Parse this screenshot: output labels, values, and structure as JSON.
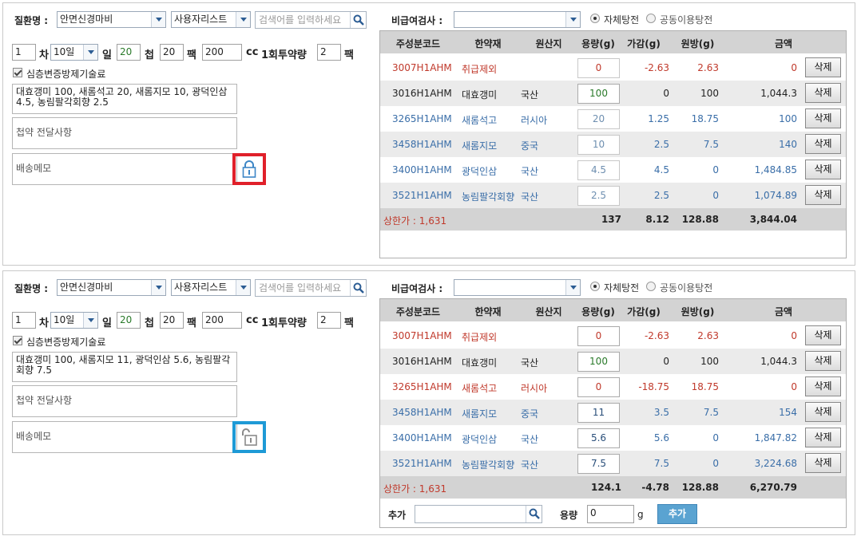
{
  "panels": [
    {
      "disease_label": "질환명 :",
      "disease_value": "안면신경마비",
      "list_value": "사용자리스트",
      "search_placeholder": "검색어를 입력하세요",
      "cha_value": "1",
      "cha_label": "차",
      "days_value": "10일",
      "il_label": "일",
      "cheop_value": "20",
      "cheop_label": "첩",
      "paek_value": "20",
      "paek_label": "팩",
      "cc_value": "200",
      "cc_label": "cc",
      "dose_label": "1회투약량",
      "dose_value": "2",
      "dose_unit": "팩",
      "check_label": "심층변증방제기술료",
      "herb_summary": "대효갱미 100, 새롬석고 20, 새롬지모 10, 광덕인삼 4.5, 농림팔각회향 2.5",
      "memo1": "첩약 전달사항",
      "memo2": "배송메모",
      "lock_state": "locked",
      "lock_color": "#e0202a",
      "clinic_label": "비급여검사 :",
      "clinic_value": "",
      "radio1": "자체탕전",
      "radio2": "공동이용탕전",
      "headers": [
        "주성분코드",
        "한약재",
        "원산지",
        "용량(g)",
        "가감(g)",
        "원방(g)",
        "금액"
      ],
      "rows": [
        {
          "code": "3007H1AHM",
          "herb": "취급제외",
          "origin": "",
          "qty": "0",
          "adj": "-2.63",
          "orig": "2.63",
          "amount": "0",
          "color": "red",
          "highlight": false,
          "del": "삭제"
        },
        {
          "code": "3016H1AHM",
          "herb": "대효갱미",
          "origin": "국산",
          "qty": "100",
          "adj": "0",
          "orig": "100",
          "amount": "1,044.3",
          "color": "blk",
          "highlight": true,
          "del": "삭제"
        },
        {
          "code": "3265H1AHM",
          "herb": "새롬석고",
          "origin": "러시아",
          "qty": "20",
          "adj": "1.25",
          "orig": "18.75",
          "amount": "100",
          "color": "blue",
          "highlight": false,
          "del": "삭제"
        },
        {
          "code": "3458H1AHM",
          "herb": "새롬지모",
          "origin": "중국",
          "qty": "10",
          "adj": "2.5",
          "orig": "7.5",
          "amount": "140",
          "color": "blue",
          "highlight": true,
          "del": "삭제"
        },
        {
          "code": "3400H1AHM",
          "herb": "광덕인삼",
          "origin": "국산",
          "qty": "4.5",
          "adj": "4.5",
          "orig": "0",
          "amount": "1,484.85",
          "color": "blue",
          "highlight": false,
          "del": "삭제"
        },
        {
          "code": "3521H1AHM",
          "herb": "농림팔각회향",
          "origin": "국산",
          "qty": "2.5",
          "adj": "2.5",
          "orig": "0",
          "amount": "1,074.89",
          "color": "blue",
          "highlight": true,
          "del": "삭제"
        }
      ],
      "limit": "상한가 : 1,631",
      "tot_qty": "137",
      "tot_adj": "8.12",
      "tot_orig": "128.88",
      "tot_amount": "3,844.04"
    },
    {
      "disease_label": "질환명 :",
      "disease_value": "안면신경마비",
      "list_value": "사용자리스트",
      "search_placeholder": "검색어를 입력하세요",
      "cha_value": "1",
      "cha_label": "차",
      "days_value": "10일",
      "il_label": "일",
      "cheop_value": "20",
      "cheop_label": "첩",
      "paek_value": "20",
      "paek_label": "팩",
      "cc_value": "200",
      "cc_label": "cc",
      "dose_label": "1회투약량",
      "dose_value": "2",
      "dose_unit": "팩",
      "check_label": "심층변증방제기술료",
      "herb_summary": "대효갱미 100, 새롬지모 11, 광덕인삼 5.6, 농림팔각회향 7.5",
      "memo1": "첩약 전달사항",
      "memo2": "배송메모",
      "lock_state": "unlocked",
      "lock_color": "#1e9ad6",
      "clinic_label": "비급여검사 :",
      "clinic_value": "",
      "radio1": "자체탕전",
      "radio2": "공동이용탕전",
      "headers": [
        "주성분코드",
        "한약재",
        "원산지",
        "용량(g)",
        "가감(g)",
        "원방(g)",
        "금액"
      ],
      "rows": [
        {
          "code": "3007H1AHM",
          "herb": "취급제외",
          "origin": "",
          "qty": "0",
          "adj": "-2.63",
          "orig": "2.63",
          "amount": "0",
          "color": "red",
          "highlight": false,
          "del": "삭제"
        },
        {
          "code": "3016H1AHM",
          "herb": "대효갱미",
          "origin": "국산",
          "qty": "100",
          "adj": "0",
          "orig": "100",
          "amount": "1,044.3",
          "color": "blk",
          "highlight": true,
          "del": "삭제"
        },
        {
          "code": "3265H1AHM",
          "herb": "새롬석고",
          "origin": "러시아",
          "qty": "0",
          "adj": "-18.75",
          "orig": "18.75",
          "amount": "0",
          "color": "red",
          "highlight": false,
          "del": "삭제"
        },
        {
          "code": "3458H1AHM",
          "herb": "새롬지모",
          "origin": "중국",
          "qty": "11",
          "adj": "3.5",
          "orig": "7.5",
          "amount": "154",
          "color": "blue",
          "highlight": true,
          "del": "삭제"
        },
        {
          "code": "3400H1AHM",
          "herb": "광덕인삼",
          "origin": "국산",
          "qty": "5.6",
          "adj": "5.6",
          "orig": "0",
          "amount": "1,847.82",
          "color": "blue",
          "highlight": false,
          "del": "삭제"
        },
        {
          "code": "3521H1AHM",
          "herb": "농림팔각회향",
          "origin": "국산",
          "qty": "7.5",
          "adj": "7.5",
          "orig": "0",
          "amount": "3,224.68",
          "color": "blue",
          "highlight": true,
          "del": "삭제"
        }
      ],
      "limit": "상한가 : 1,631",
      "tot_qty": "124.1",
      "tot_adj": "-4.78",
      "tot_orig": "128.88",
      "tot_amount": "6,270.79",
      "add_label": "추가",
      "add_search_value": "",
      "add_qty_label": "용량",
      "add_qty_value": "0",
      "add_unit": "g",
      "add_button": "추가"
    }
  ]
}
